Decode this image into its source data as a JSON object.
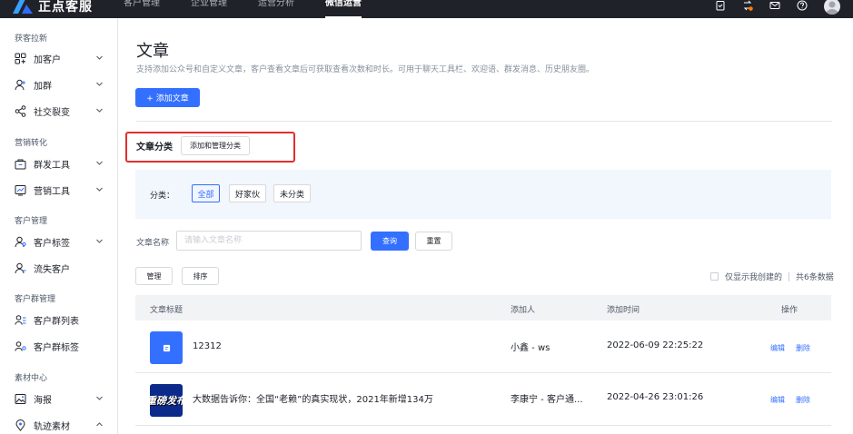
{
  "topbar": {
    "logo_text": "正点客服",
    "nav": [
      "客户管理",
      "企业管理",
      "运营分析",
      "微信运营"
    ],
    "active_index": 3,
    "icons": [
      "clipboard-icon",
      "switch-org-icon",
      "mail-icon",
      "help-icon"
    ]
  },
  "sidebar": {
    "groups": [
      {
        "label": "获客拉新",
        "items": [
          {
            "label": "加客户",
            "icon": "grid-icon",
            "chevron": "down"
          },
          {
            "label": "加群",
            "icon": "user-add-icon",
            "chevron": "down"
          },
          {
            "label": "社交裂变",
            "icon": "share-icon",
            "chevron": "down"
          }
        ]
      },
      {
        "label": "营销转化",
        "items": [
          {
            "label": "群发工具",
            "icon": "bag-icon",
            "chevron": "down"
          },
          {
            "label": "营销工具",
            "icon": "chart-icon",
            "chevron": "down"
          }
        ]
      },
      {
        "label": "客户管理",
        "items": [
          {
            "label": "客户标签",
            "icon": "user-tag-icon",
            "chevron": "down"
          },
          {
            "label": "流失客户",
            "icon": "user-lost-icon",
            "chevron": ""
          }
        ]
      },
      {
        "label": "客户群管理",
        "items": [
          {
            "label": "客户群列表",
            "icon": "group-list-icon",
            "chevron": ""
          },
          {
            "label": "客户群标签",
            "icon": "group-tag-icon",
            "chevron": ""
          }
        ]
      },
      {
        "label": "素材中心",
        "items": [
          {
            "label": "海报",
            "icon": "image-icon",
            "chevron": "down"
          },
          {
            "label": "轨迹素材",
            "icon": "location-icon",
            "chevron": "up"
          }
        ]
      }
    ]
  },
  "page": {
    "title": "文章",
    "description": "支持添加公众号和自定义文章，客户查看文章后可获取查看次数和时长。可用于聊天工具栏、欢迎语、群发消息、历史朋友圈。",
    "add_button": "+ 添加文章"
  },
  "category": {
    "title": "文章分类",
    "manage_button": "添加和管理分类",
    "filter_label": "分类：",
    "chips": [
      "全部",
      "好家伙",
      "未分类"
    ],
    "active_chip": 0
  },
  "search": {
    "label": "文章名称",
    "placeholder": "请输入文章名称",
    "query_button": "查询",
    "reset_button": "重置"
  },
  "toolbar": {
    "manage_button": "管理",
    "sort_button": "排序",
    "only_mine_label": "仅显示我创建的",
    "total_label": "共6条数据"
  },
  "table": {
    "columns": [
      "文章标题",
      "添加人",
      "添加时间",
      "操作"
    ],
    "rows": [
      {
        "title": "12312",
        "adder": "小鑫 - ws",
        "time": "2022-06-09 22:25:22",
        "edit": "编辑",
        "delete": "删除",
        "thumb": "doc-thumbnail-icon"
      },
      {
        "title": "大数据告诉你：全国“老赖”的真实现状，2021年新增134万",
        "adder": "李康宁 - 客户通...",
        "time": "2022-04-26 23:01:26",
        "edit": "编辑",
        "delete": "删除",
        "thumb": "news-cover-image",
        "thumb_text": "重磅发布"
      }
    ]
  },
  "colors": {
    "primary": "#3370ff",
    "topbar": "#1f2329",
    "highlight": "#e02f2f",
    "panel": "#f2f6fd"
  }
}
